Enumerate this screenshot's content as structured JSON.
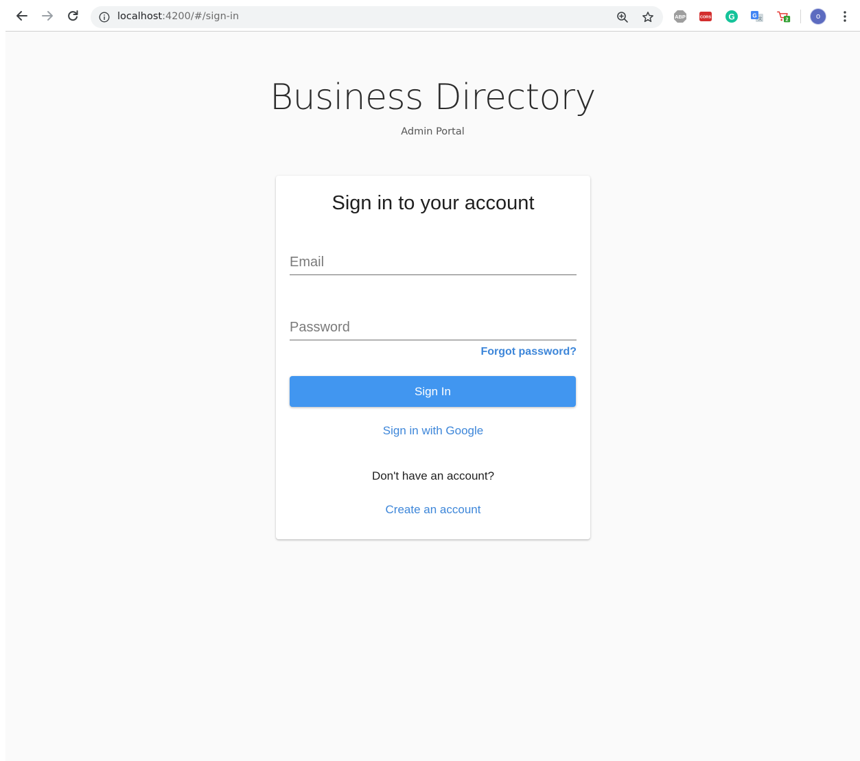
{
  "browser": {
    "url_host": "localhost",
    "url_path": ":4200/#/sign-in",
    "extensions": [
      {
        "name": "abp-icon",
        "label": "ABP"
      },
      {
        "name": "cors-icon",
        "label": "CORS"
      },
      {
        "name": "grammarly-icon",
        "label": "G"
      },
      {
        "name": "translate-icon",
        "label": ""
      },
      {
        "name": "shopping-cart-icon",
        "label": "2"
      }
    ],
    "avatar_initial": "o"
  },
  "header": {
    "title": "Business Directory",
    "subtitle": "Admin Portal"
  },
  "signin": {
    "title": "Sign in to your account",
    "email_placeholder": "Email",
    "email_value": "",
    "password_placeholder": "Password",
    "password_value": "",
    "forgot_label": "Forgot password?",
    "submit_label": "Sign In",
    "google_label": "Sign in with Google",
    "no_account_text": "Don't have an account?",
    "create_label": "Create an account"
  },
  "colors": {
    "accent": "#4196f0",
    "link": "#3d86d9",
    "background": "#fafafa"
  }
}
